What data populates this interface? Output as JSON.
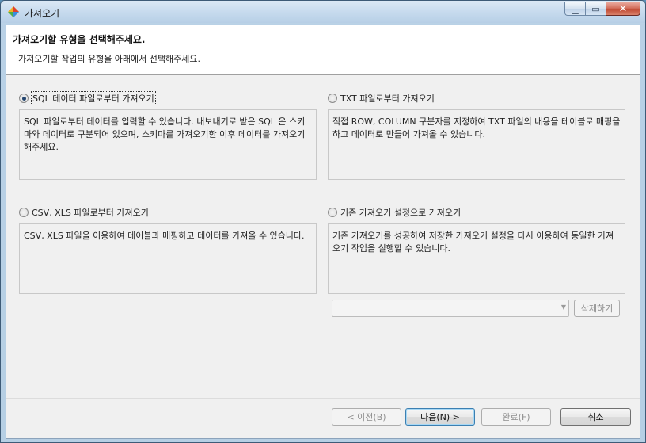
{
  "window": {
    "title": "가져오기",
    "icon": "app-diamond-icon",
    "controls": {
      "minimize": "minimize-icon",
      "maximize": "maximize-icon",
      "close": "close-icon"
    }
  },
  "header": {
    "title": "가져오기할 유형을 선택해주세요.",
    "description": "가져오기할 작업의 유형을 아래에서 선택해주세요."
  },
  "options": [
    {
      "label": "SQL 데이터 파일로부터 가져오기",
      "checked": true,
      "description": "SQL 파일로부터 데이터를 입력할 수 있습니다. 내보내기로 받은 SQL 은 스키마와 데이터로 구분되어 있으며, 스키마를 가져오기한 이후 데이터를 가져오기해주세요."
    },
    {
      "label": "TXT 파일로부터 가져오기",
      "checked": false,
      "description": "직접 ROW, COLUMN 구분자를 지정하여 TXT 파일의 내용을 테이블로 매핑을 하고 데이터로 만들어 가져올 수 있습니다."
    },
    {
      "label": "CSV, XLS 파일로부터 가져오기",
      "checked": false,
      "description": "CSV, XLS 파일을 이용하여 테이블과 매핑하고 데이터를 가져올 수 있습니다."
    },
    {
      "label": "기존 가져오기 설정으로 가져오기",
      "checked": false,
      "description": "기존 가져오기를 성공하여 저장한 가져오기 설정을 다시 이용하여 동일한 가져오기 작업을 실행할 수 있습니다."
    }
  ],
  "saved_settings": {
    "selected": "",
    "delete_label": "삭제하기"
  },
  "footer": {
    "back_label": "< 이전(B)",
    "next_label": "다음(N) >",
    "finish_label": "완료(F)",
    "cancel_label": "취소"
  }
}
